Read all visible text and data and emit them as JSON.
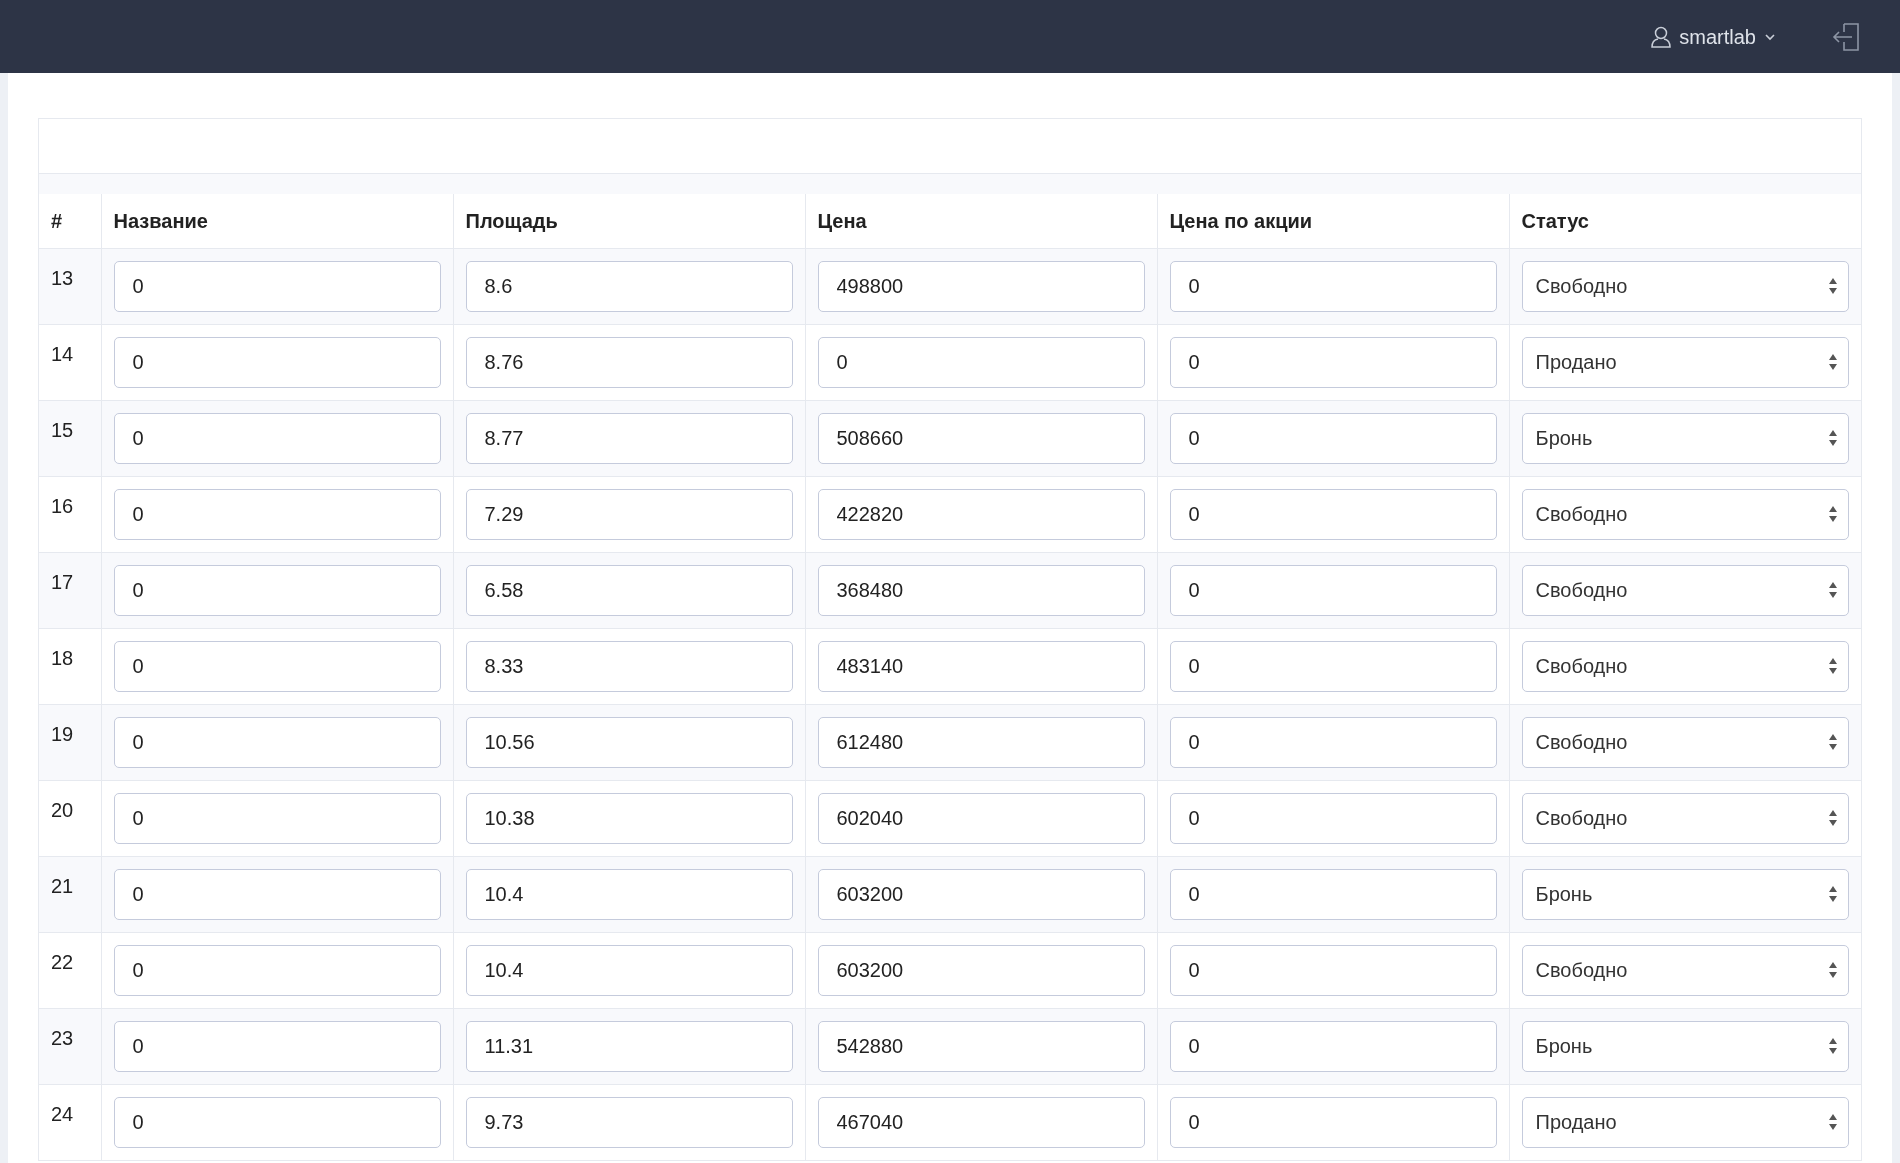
{
  "topbar": {
    "username": "smartlab"
  },
  "table": {
    "columns": [
      "#",
      "Название",
      "Площадь",
      "Цена",
      "Цена по акции",
      "Статус"
    ],
    "rows": [
      {
        "number": "13",
        "name": "0",
        "area": "8.6",
        "price": "498800",
        "promo_price": "0",
        "status": "Свободно"
      },
      {
        "number": "14",
        "name": "0",
        "area": "8.76",
        "price": "0",
        "promo_price": "0",
        "status": "Продано"
      },
      {
        "number": "15",
        "name": "0",
        "area": "8.77",
        "price": "508660",
        "promo_price": "0",
        "status": "Бронь"
      },
      {
        "number": "16",
        "name": "0",
        "area": "7.29",
        "price": "422820",
        "promo_price": "0",
        "status": "Свободно"
      },
      {
        "number": "17",
        "name": "0",
        "area": "6.58",
        "price": "368480",
        "promo_price": "0",
        "status": "Свободно"
      },
      {
        "number": "18",
        "name": "0",
        "area": "8.33",
        "price": "483140",
        "promo_price": "0",
        "status": "Свободно"
      },
      {
        "number": "19",
        "name": "0",
        "area": "10.56",
        "price": "612480",
        "promo_price": "0",
        "status": "Свободно"
      },
      {
        "number": "20",
        "name": "0",
        "area": "10.38",
        "price": "602040",
        "promo_price": "0",
        "status": "Свободно"
      },
      {
        "number": "21",
        "name": "0",
        "area": "10.4",
        "price": "603200",
        "promo_price": "0",
        "status": "Бронь"
      },
      {
        "number": "22",
        "name": "0",
        "area": "10.4",
        "price": "603200",
        "promo_price": "0",
        "status": "Свободно"
      },
      {
        "number": "23",
        "name": "0",
        "area": "11.31",
        "price": "542880",
        "promo_price": "0",
        "status": "Бронь"
      },
      {
        "number": "24",
        "name": "0",
        "area": "9.73",
        "price": "467040",
        "promo_price": "0",
        "status": "Продано"
      }
    ]
  }
}
